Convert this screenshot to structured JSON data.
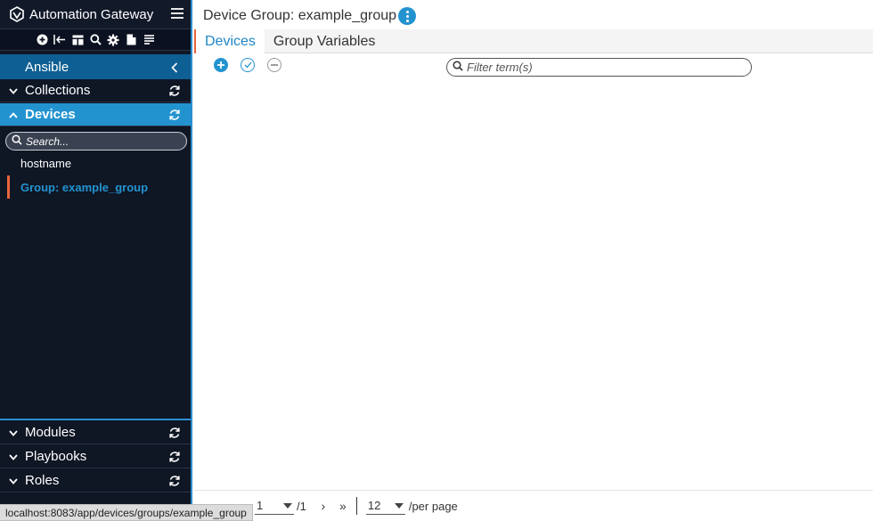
{
  "app": {
    "title": "Automation Gateway"
  },
  "toolbar": {
    "icons": [
      "add-circle-icon",
      "logout-icon",
      "dashboard-icon",
      "search-icon",
      "gear-icon",
      "file-icon",
      "list-icon"
    ]
  },
  "sidebar": {
    "section": "Ansible",
    "collections": "Collections",
    "devices": "Devices",
    "search_placeholder": "Search...",
    "device_items": [
      "hostname",
      "Group: example_group"
    ],
    "modules": "Modules",
    "playbooks": "Playbooks",
    "roles": "Roles"
  },
  "main": {
    "title": "Device Group: example_group",
    "tabs": [
      "Devices",
      "Group Variables"
    ],
    "active_tab": "Devices",
    "filter_placeholder": "Filter term(s)"
  },
  "pagination": {
    "current_page": "1",
    "total_pages": "/1",
    "per_page": "12",
    "per_page_label": "/per page",
    "next": "›",
    "last": "»"
  },
  "status_url": "localhost:8083/app/devices/groups/example_group",
  "colors": {
    "accent": "#2393d0",
    "sidebar_bg": "#0f1624",
    "section_bg": "#0e5f93",
    "indicator": "#e8643c"
  }
}
